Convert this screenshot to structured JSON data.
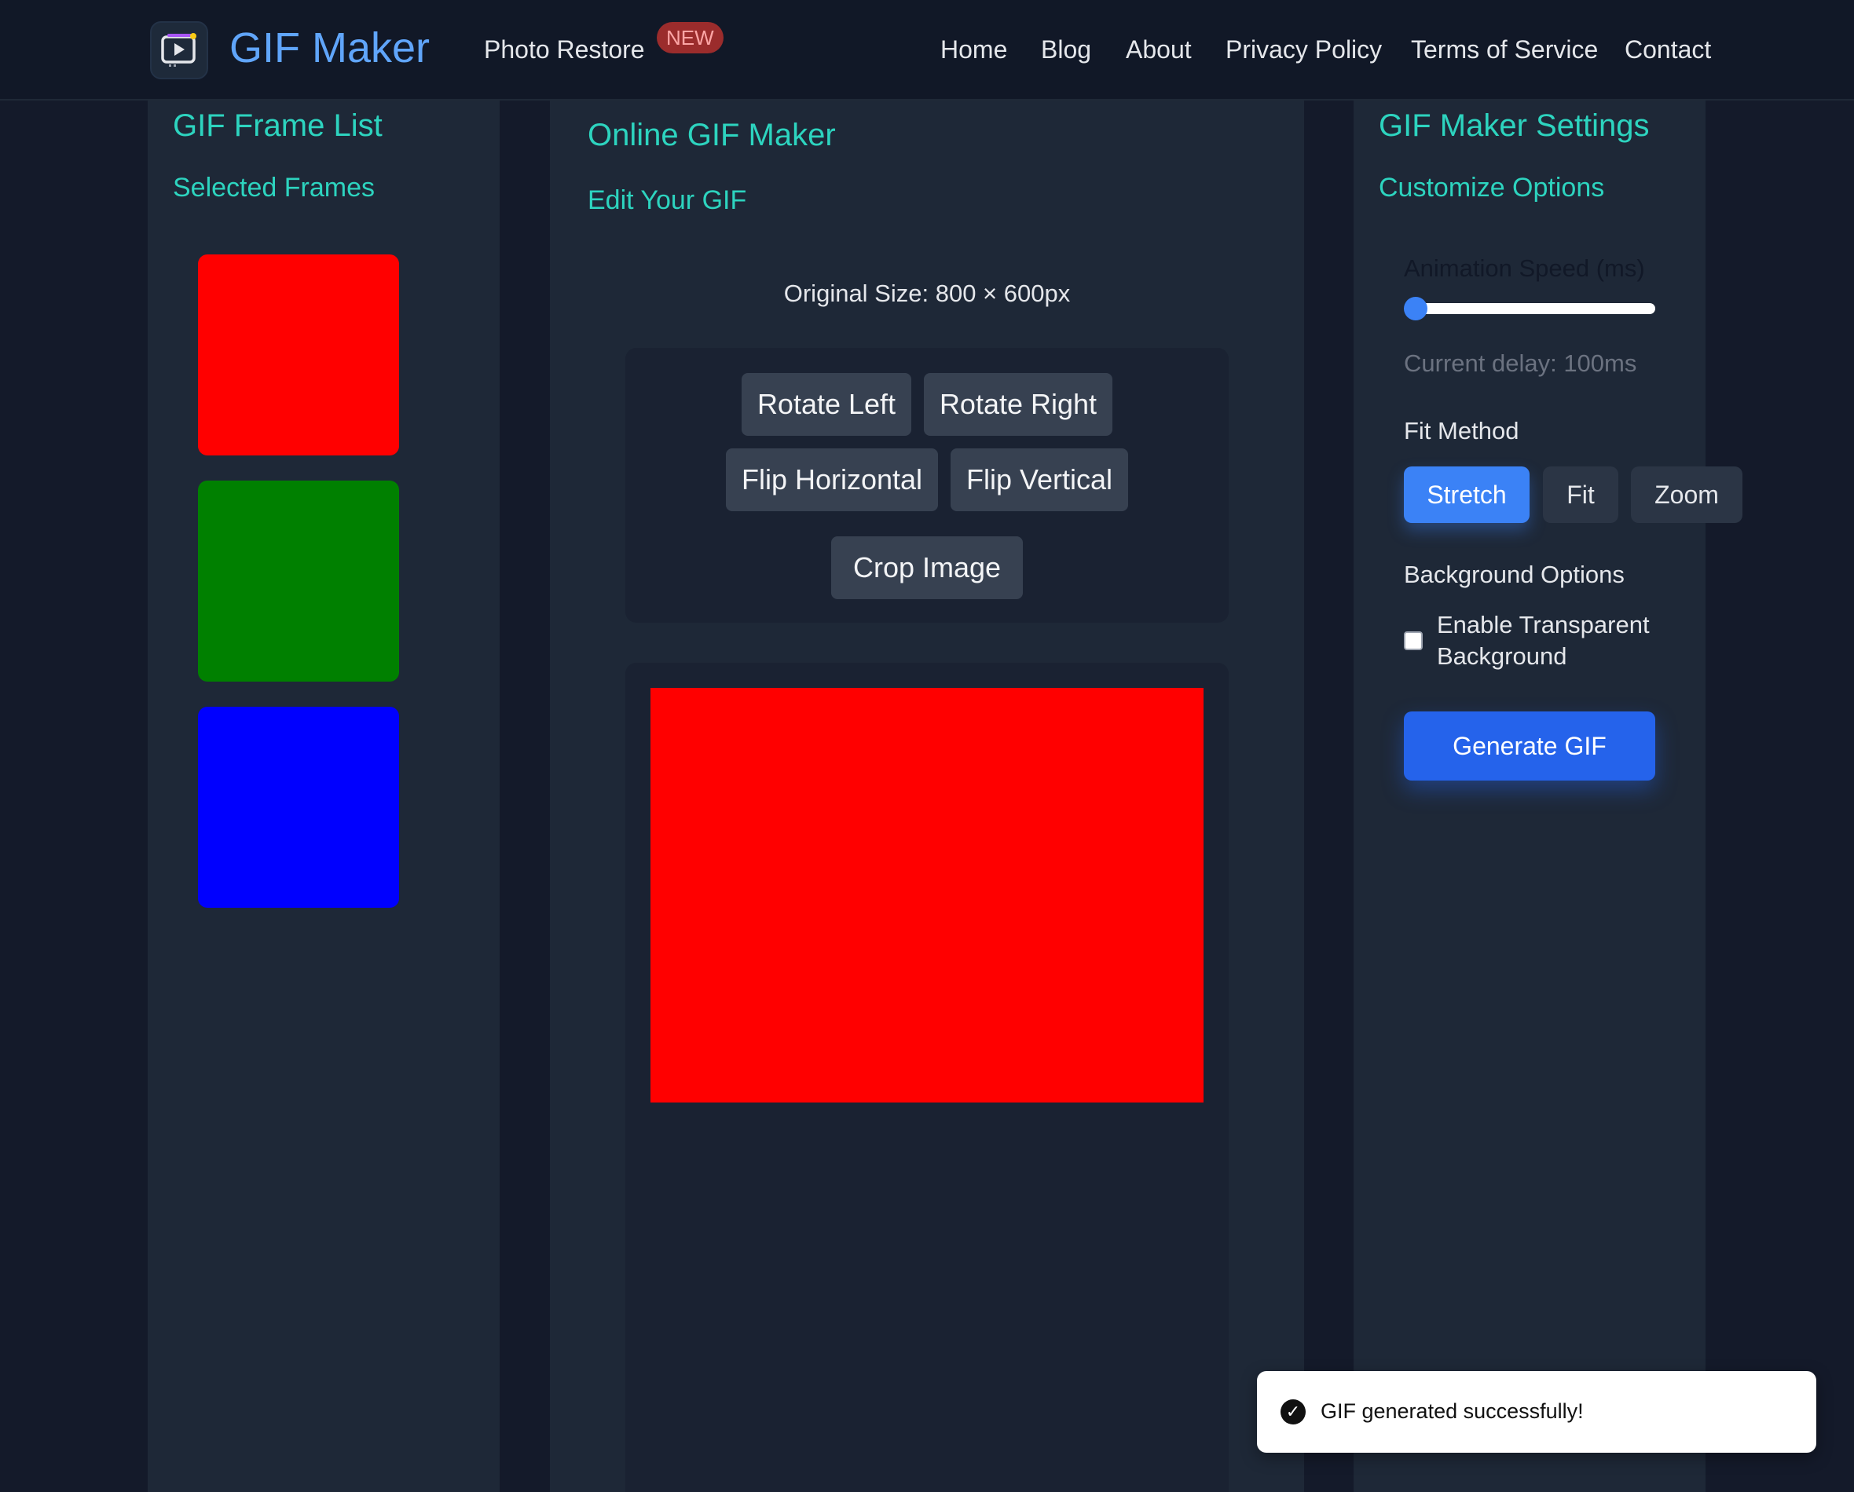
{
  "header": {
    "brand": "GIF Maker",
    "photo_restore": "Photo Restore",
    "new_badge": "NEW",
    "nav": [
      "Home",
      "Blog",
      "About",
      "Privacy Policy",
      "Terms of Service",
      "Contact"
    ]
  },
  "left_panel": {
    "title": "GIF Frame List",
    "subtitle": "Selected Frames",
    "frames": [
      {
        "color": "#ff0000"
      },
      {
        "color": "#008000"
      },
      {
        "color": "#0000ff"
      }
    ]
  },
  "center_panel": {
    "title": "Online GIF Maker",
    "subtitle": "Edit Your GIF",
    "original_size": "Original Size: 800 × 600px",
    "tools": {
      "rotate_left": "Rotate Left",
      "rotate_right": "Rotate Right",
      "flip_horizontal": "Flip Horizontal",
      "flip_vertical": "Flip Vertical",
      "crop": "Crop Image"
    },
    "preview_color": "#ff0000"
  },
  "right_panel": {
    "title": "GIF Maker Settings",
    "subtitle": "Customize Options",
    "speed_label": "Animation Speed (ms)",
    "speed_value": 0,
    "delay_text": "Current delay: 100ms",
    "fit_label": "Fit Method",
    "fit_options": [
      "Stretch",
      "Fit",
      "Zoom"
    ],
    "fit_selected": "Stretch",
    "bg_label": "Background Options",
    "transparent_label_line1": "Enable Transparent",
    "transparent_label_line2": "Background",
    "transparent_checked": false,
    "generate": "Generate GIF"
  },
  "toast": {
    "message": "GIF generated successfully!"
  },
  "colors": {
    "accent": "#2dd4bf",
    "brand": "#60a5fa",
    "primary": "#3b82f6"
  }
}
